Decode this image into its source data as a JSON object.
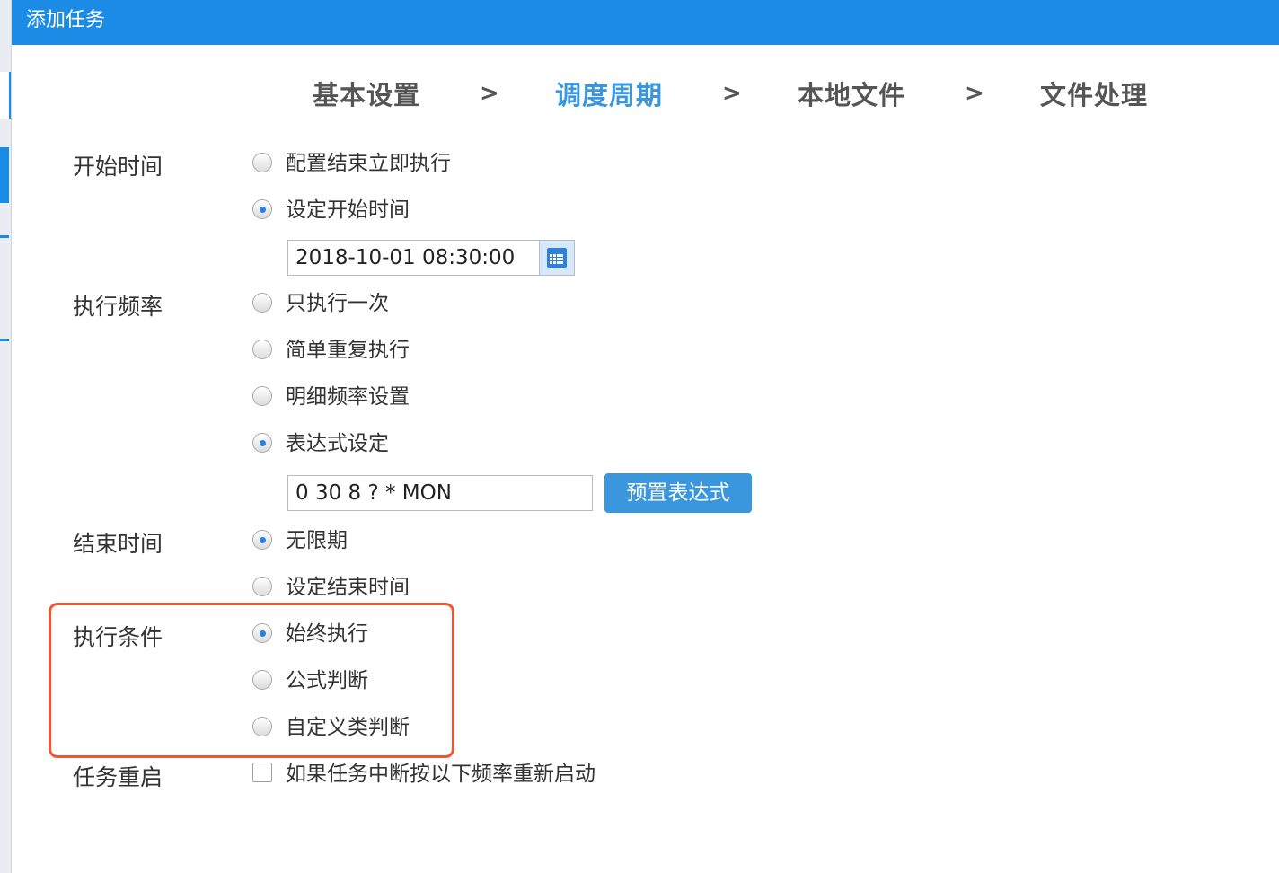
{
  "dialog": {
    "title": "添加任务"
  },
  "steps": [
    {
      "label": "基本设置",
      "active": false
    },
    {
      "label": "调度周期",
      "active": true
    },
    {
      "label": "本地文件",
      "active": false
    },
    {
      "label": "文件处理",
      "active": false
    }
  ],
  "step_separator": ">",
  "sections": {
    "start_time": {
      "label": "开始时间",
      "options": [
        "配置结束立即执行",
        "设定开始时间"
      ],
      "selected": "设定开始时间",
      "datetime_value": "2018-10-01 08:30:00",
      "calendar_icon": "calendar-icon"
    },
    "frequency": {
      "label": "执行频率",
      "options": [
        "只执行一次",
        "简单重复执行",
        "明细频率设置",
        "表达式设定"
      ],
      "selected": "表达式设定",
      "expression_value": "0 30 8 ? * MON",
      "preset_button": "预置表达式"
    },
    "end_time": {
      "label": "结束时间",
      "options": [
        "无限期",
        "设定结束时间"
      ],
      "selected": "无限期"
    },
    "condition": {
      "label": "执行条件",
      "options": [
        "始终执行",
        "公式判断",
        "自定义类判断"
      ],
      "selected": "始终执行"
    },
    "restart": {
      "label": "任务重启",
      "checkbox_label": "如果任务中断按以下频率重新启动",
      "checked": false
    }
  },
  "colors": {
    "titlebar": "#1b8be6",
    "active_step": "#3a97de",
    "button": "#3a97de",
    "highlight_border": "#f25532"
  }
}
